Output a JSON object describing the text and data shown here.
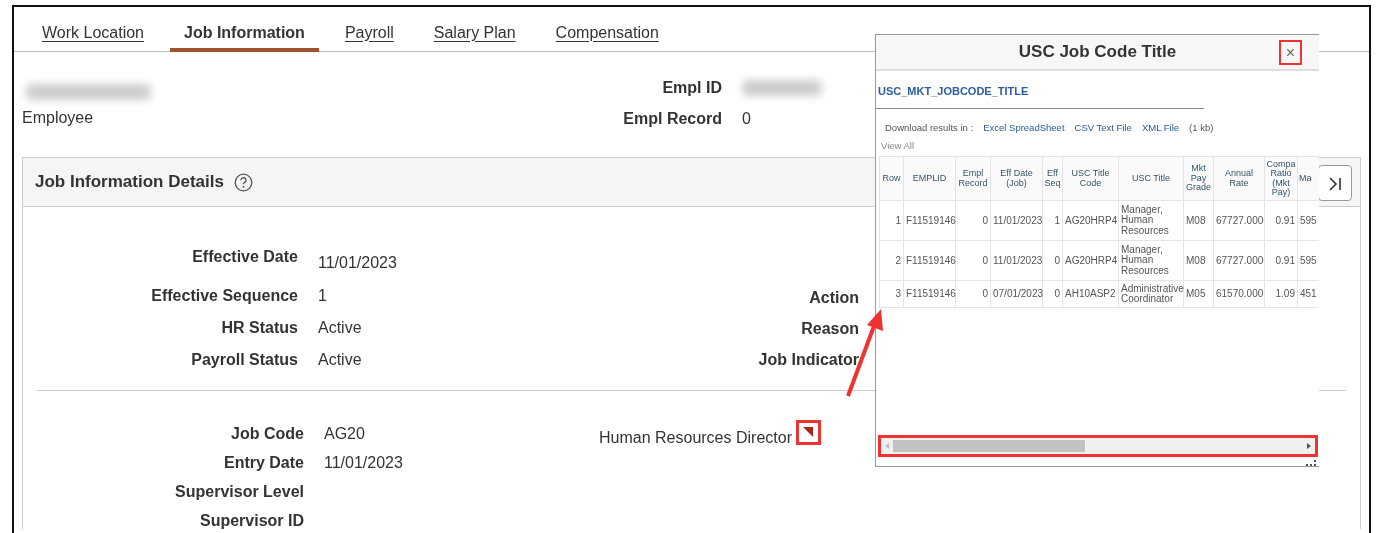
{
  "tabs": [
    {
      "label": "Work Location",
      "selected": false
    },
    {
      "label": "Job Information",
      "selected": true
    },
    {
      "label": "Payroll",
      "selected": false
    },
    {
      "label": "Salary Plan",
      "selected": false
    },
    {
      "label": "Compensation",
      "selected": false
    }
  ],
  "header": {
    "employee_label": "Employee",
    "fields": [
      {
        "label": "Empl ID",
        "kind": "redacted"
      },
      {
        "label": "Empl Record",
        "kind": "text",
        "value": "0"
      }
    ]
  },
  "details": {
    "title": "Job Information Details",
    "status_rows": [
      {
        "label": "Effective Date",
        "value": "11/01/2023"
      },
      {
        "label": "Effective Sequence",
        "value": "1"
      },
      {
        "label": "HR Status",
        "value": "Active"
      },
      {
        "label": "Payroll Status",
        "value": "Active"
      }
    ],
    "right_labels": [
      "Action",
      "Reason",
      "Job Indicator"
    ],
    "job_rows": [
      {
        "label": "Job Code",
        "value": "AG20"
      },
      {
        "label": "Entry Date",
        "value": "11/01/2023"
      },
      {
        "label": "Supervisor Level"
      },
      {
        "label": "Supervisor ID"
      }
    ],
    "job_code_description": "Human Resources Director"
  },
  "popup": {
    "title": "USC Job Code Title",
    "close_glyph": "×",
    "query_name": "USC_MKT_JOBCODE_TITLE",
    "download_label": "Download results in :",
    "download_links": [
      "Excel SpreadSheet",
      "CSV Text File",
      "XML File"
    ],
    "size": "(1 kb)",
    "view_all": "View All",
    "columns": [
      "Row",
      "EMPLID",
      "Empl Record",
      "Eff Date (Job)",
      "Eff Seq",
      "USC Title Code",
      "USC Title",
      "Mkt Pay Grade",
      "Annual Rate",
      "Compa Ratio (Mkt Pay)",
      "Ma"
    ],
    "rows": [
      [
        "1",
        "F11519146",
        "0",
        "11/01/2023",
        "1",
        "AG20HRP4",
        "Manager, Human Resources",
        "M08",
        "67727.000",
        "0.91",
        "595"
      ],
      [
        "2",
        "F11519146",
        "0",
        "11/01/2023",
        "0",
        "AG20HRP4",
        "Manager, Human Resources",
        "M08",
        "67727.000",
        "0.91",
        "595"
      ],
      [
        "3",
        "F11519146",
        "0",
        "07/01/2023",
        "0",
        "AH10ASP2",
        "Administrative Coordinator",
        "M05",
        "61570.000",
        "1.09",
        "451"
      ]
    ]
  }
}
